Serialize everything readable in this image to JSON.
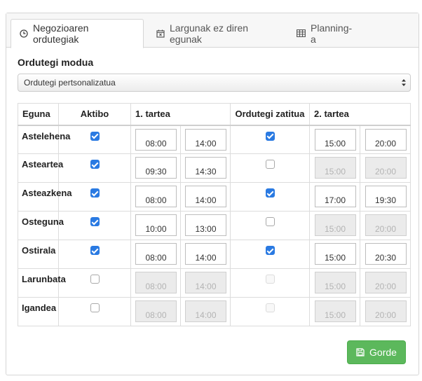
{
  "tabs": [
    {
      "label": "Negozioaren ordutegiak",
      "icon": "clock-icon"
    },
    {
      "label": "Largunak ez diren egunak",
      "icon": "calendar-x-icon"
    },
    {
      "label": "Planning-a",
      "icon": "table-icon"
    }
  ],
  "schedule_mode": {
    "label": "Ordutegi modua",
    "selected": "Ordutegi pertsonalizatua"
  },
  "table": {
    "headers": [
      "Eguna",
      "Aktibo",
      "1. tartea",
      "Ordutegi zatitua",
      "2. tartea"
    ],
    "rows": [
      {
        "day": "Astelehena",
        "active": true,
        "r1_start": "08:00",
        "r1_end": "14:00",
        "split": true,
        "r2_start": "15:00",
        "r2_end": "20:00"
      },
      {
        "day": "Asteartea",
        "active": true,
        "r1_start": "09:30",
        "r1_end": "14:30",
        "split": false,
        "r2_start": "15:00",
        "r2_end": "20:00"
      },
      {
        "day": "Asteazkena",
        "active": true,
        "r1_start": "08:00",
        "r1_end": "14:00",
        "split": true,
        "r2_start": "17:00",
        "r2_end": "19:30"
      },
      {
        "day": "Osteguna",
        "active": true,
        "r1_start": "10:00",
        "r1_end": "13:00",
        "split": false,
        "r2_start": "15:00",
        "r2_end": "20:00"
      },
      {
        "day": "Ostirala",
        "active": true,
        "r1_start": "08:00",
        "r1_end": "14:00",
        "split": true,
        "r2_start": "15:00",
        "r2_end": "20:30"
      },
      {
        "day": "Larunbata",
        "active": false,
        "r1_start": "08:00",
        "r1_end": "14:00",
        "split": false,
        "r2_start": "15:00",
        "r2_end": "20:00"
      },
      {
        "day": "Igandea",
        "active": false,
        "r1_start": "08:00",
        "r1_end": "14:00",
        "split": false,
        "r2_start": "15:00",
        "r2_end": "20:00"
      }
    ]
  },
  "save_button": {
    "label": "Gorde",
    "icon": "save-icon",
    "color": "#5cb85c"
  },
  "colors": {
    "checkbox_checked": "#2a7ae2",
    "disabled_input": "#ebebeb"
  }
}
